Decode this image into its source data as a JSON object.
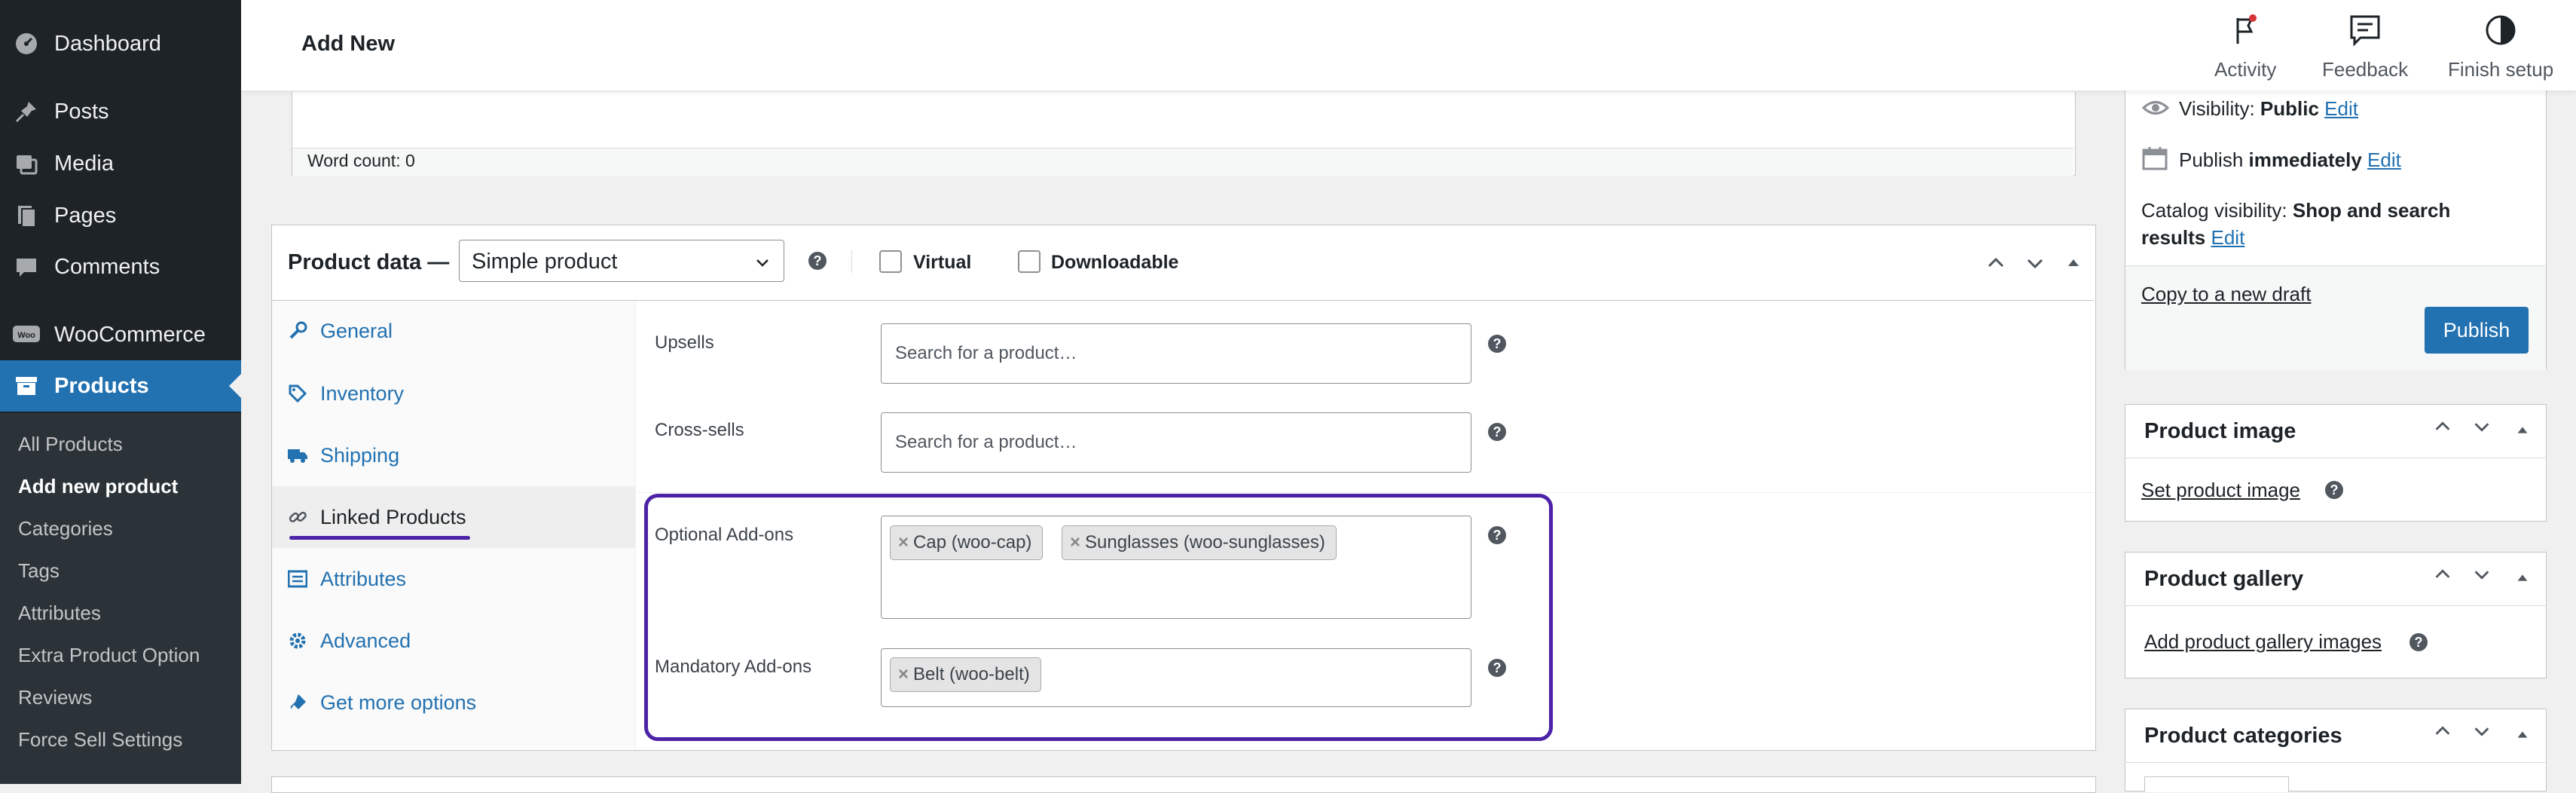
{
  "sidebar": {
    "items": [
      {
        "label": "Dashboard",
        "icon": "dashboard-icon"
      },
      {
        "label": "Posts",
        "icon": "pin-icon"
      },
      {
        "label": "Media",
        "icon": "media-icon"
      },
      {
        "label": "Pages",
        "icon": "pages-icon"
      },
      {
        "label": "Comments",
        "icon": "comments-icon"
      },
      {
        "label": "WooCommerce",
        "icon": "woo-icon"
      },
      {
        "label": "Products",
        "icon": "archive-icon"
      }
    ],
    "submenu": [
      "All Products",
      "Add new product",
      "Categories",
      "Tags",
      "Attributes",
      "Extra Product Option",
      "Reviews",
      "Force Sell Settings"
    ]
  },
  "header": {
    "title": "Add New",
    "actions": {
      "activity": "Activity",
      "feedback": "Feedback",
      "finish": "Finish setup"
    }
  },
  "editor": {
    "word_count": "Word count: 0"
  },
  "product_data": {
    "title": "Product data —",
    "type": "Simple product",
    "virtual": "Virtual",
    "downloadable": "Downloadable",
    "tabs": [
      {
        "label": "General",
        "icon": "wrench-icon"
      },
      {
        "label": "Inventory",
        "icon": "tag-icon"
      },
      {
        "label": "Shipping",
        "icon": "truck-icon"
      },
      {
        "label": "Linked Products",
        "icon": "link-icon"
      },
      {
        "label": "Attributes",
        "icon": "list-icon"
      },
      {
        "label": "Advanced",
        "icon": "gear-icon"
      },
      {
        "label": "Get more options",
        "icon": "plugin-icon"
      }
    ],
    "fields": {
      "upsells_label": "Upsells",
      "upsells_placeholder": "Search for a product…",
      "crosssells_label": "Cross-sells",
      "crosssells_placeholder": "Search for a product…",
      "optional_label": "Optional Add-ons",
      "optional_chips": [
        "Cap (woo-cap)",
        "Sunglasses (woo-sunglasses)"
      ],
      "mandatory_label": "Mandatory Add-ons",
      "mandatory_chips": [
        "Belt (woo-belt)"
      ]
    },
    "highlight_color": "#4c22a6"
  },
  "publish_box": {
    "visibility_label": "Visibility:",
    "visibility_value": "Public",
    "publish_label": "Publish",
    "publish_value": "immediately",
    "edit": "Edit",
    "catalog_label": "Catalog visibility:",
    "catalog_value_1": "Shop and search",
    "catalog_value_2": "results",
    "copy_draft": "Copy to a new draft",
    "publish_button": "Publish"
  },
  "product_image": {
    "title": "Product image",
    "link": "Set product image"
  },
  "product_gallery": {
    "title": "Product gallery",
    "link": "Add product gallery images"
  },
  "product_categories": {
    "title": "Product categories"
  },
  "colors": {
    "sidebar_bg": "#1d2327",
    "accent": "#2271b1",
    "highlight": "#4c22a6"
  }
}
